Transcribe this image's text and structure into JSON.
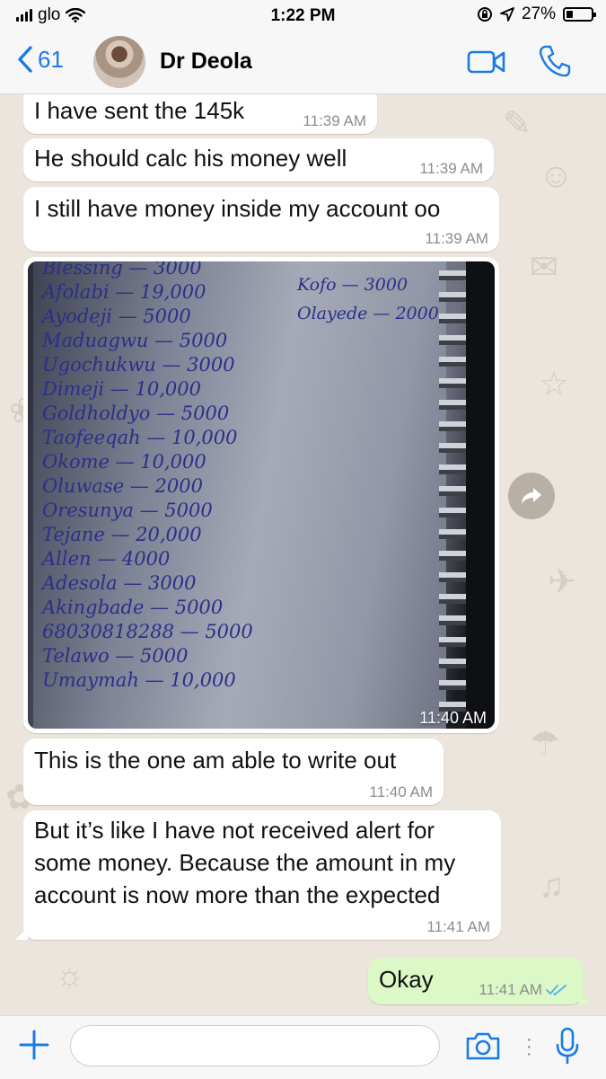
{
  "status_bar": {
    "carrier": "glo",
    "time": "1:22 PM",
    "battery": "27%",
    "battery_level": 0.27
  },
  "header": {
    "back_count": "61",
    "contact_name": "Dr Deola",
    "icons": [
      "chevron-left-icon",
      "video-icon",
      "phone-icon"
    ]
  },
  "messages": [
    {
      "direction": "in",
      "text": "I have sent the 145k",
      "time": "11:39 AM"
    },
    {
      "direction": "in",
      "text": "He should calc his money well",
      "time": "11:39 AM"
    },
    {
      "direction": "in",
      "text": "I still have money inside my account oo",
      "time": "11:39 AM"
    },
    {
      "direction": "in",
      "type": "image",
      "time": "11:40 AM",
      "image_lines_left": [
        "Blessing — 3000",
        "Afolabi — 19,000",
        "Ayodeji — 5000",
        "Maduagwu — 5000",
        "Ugochukwu — 3000",
        "Dimeji — 10,000",
        "Goldholdyo — 5000",
        "Taofeeqah — 10,000",
        "Okome — 10,000",
        "Oluwase — 2000",
        "Oresunya — 5000",
        "Tejane — 20,000",
        "Allen — 4000",
        "Adesola — 3000",
        "Akingbade — 5000",
        "68030818288 — 5000",
        "Telawo — 5000",
        "Umaymah — 10,000"
      ],
      "image_lines_right": [
        "Kofo — 3000",
        "Olayede — 2000"
      ]
    },
    {
      "direction": "in",
      "text": "This is the one am able to write out",
      "time": "11:40 AM"
    },
    {
      "direction": "in",
      "text": "But it’s like I have not received alert for some money. Because the amount in my account is now more than the expected",
      "time": "11:41 AM"
    },
    {
      "direction": "out",
      "text": "Okay",
      "time": "11:41 AM",
      "status": "read"
    }
  ],
  "composer": {
    "placeholder": "",
    "icons": [
      "plus-icon",
      "camera-icon",
      "microphone-icon"
    ]
  },
  "colors": {
    "accent": "#1b7be6",
    "chat_background": "#ece5dd",
    "incoming_bubble": "#ffffff",
    "outgoing_bubble": "#dcf8c6",
    "read_ticks": "#4fb6ec"
  }
}
